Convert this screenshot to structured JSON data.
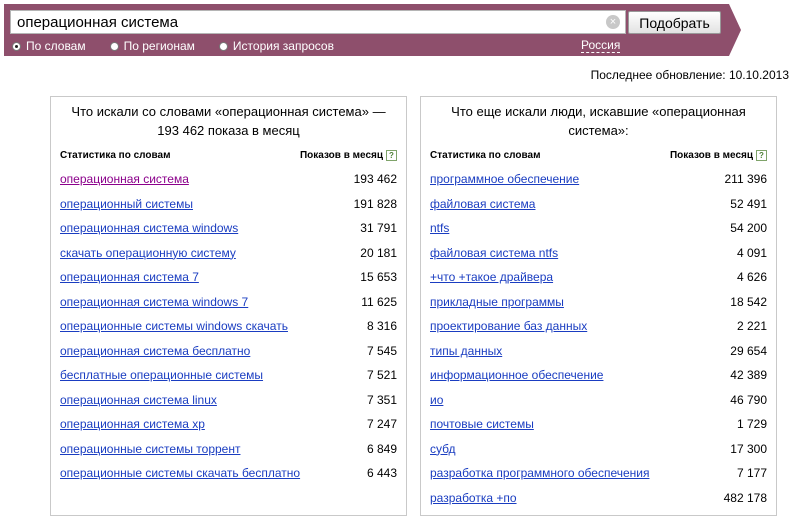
{
  "search": {
    "query": "операционная система",
    "button_label": "Подобрать",
    "clear_glyph": "×"
  },
  "modes": [
    {
      "label": "По словам",
      "selected": true
    },
    {
      "label": "По регионам",
      "selected": false
    },
    {
      "label": "История запросов",
      "selected": false
    }
  ],
  "region": "Россия",
  "updated": "Последнее обновление: 10.10.2013",
  "colors": {
    "topbar": "#8e4f6c",
    "link": "#1a3dc1",
    "visited": "#8b008b"
  },
  "left_panel": {
    "title": "Что искали со словами «операционная система» — 193 462 показа в месяц",
    "col_words": "Статистика по словам",
    "col_shows": "Показов в месяц",
    "help_glyph": "?",
    "rows": [
      {
        "text": "операционная система",
        "count": "193 462",
        "visited": true
      },
      {
        "text": "операционный системы",
        "count": "191 828"
      },
      {
        "text": "операционная система windows",
        "count": "31 791"
      },
      {
        "text": "скачать операционную систему",
        "count": "20 181"
      },
      {
        "text": "операционная система 7",
        "count": "15 653"
      },
      {
        "text": "операционная система windows 7",
        "count": "11 625"
      },
      {
        "text": "операционные системы windows скачать",
        "count": "8 316"
      },
      {
        "text": "операционная система бесплатно",
        "count": "7 545"
      },
      {
        "text": "бесплатные операционные системы",
        "count": "7 521"
      },
      {
        "text": "операционная система linux",
        "count": "7 351"
      },
      {
        "text": "операционная система xp",
        "count": "7 247"
      },
      {
        "text": "операционные системы торрент",
        "count": "6 849"
      },
      {
        "text": "операционные системы скачать бесплатно",
        "count": "6 443"
      }
    ]
  },
  "right_panel": {
    "title": "Что еще искали люди, искавшие «операционная система»:",
    "col_words": "Статистика по словам",
    "col_shows": "Показов в месяц",
    "help_glyph": "?",
    "rows": [
      {
        "text": "программное обеспечение",
        "count": "211 396"
      },
      {
        "text": "файловая система",
        "count": "52 491"
      },
      {
        "text": "ntfs",
        "count": "54 200"
      },
      {
        "text": "файловая система ntfs",
        "count": "4 091"
      },
      {
        "text": "+что +такое драйвера",
        "count": "4 626"
      },
      {
        "text": "прикладные программы",
        "count": "18 542"
      },
      {
        "text": "проектирование баз данных",
        "count": "2 221"
      },
      {
        "text": "типы данных",
        "count": "29 654"
      },
      {
        "text": "информационное обеспечение",
        "count": "42 389"
      },
      {
        "text": "ио",
        "count": "46 790"
      },
      {
        "text": "почтовые системы",
        "count": "1 729"
      },
      {
        "text": "субд",
        "count": "17 300"
      },
      {
        "text": "разработка программного обеспечения",
        "count": "7 177"
      },
      {
        "text": "разработка +по",
        "count": "482 178"
      }
    ]
  }
}
